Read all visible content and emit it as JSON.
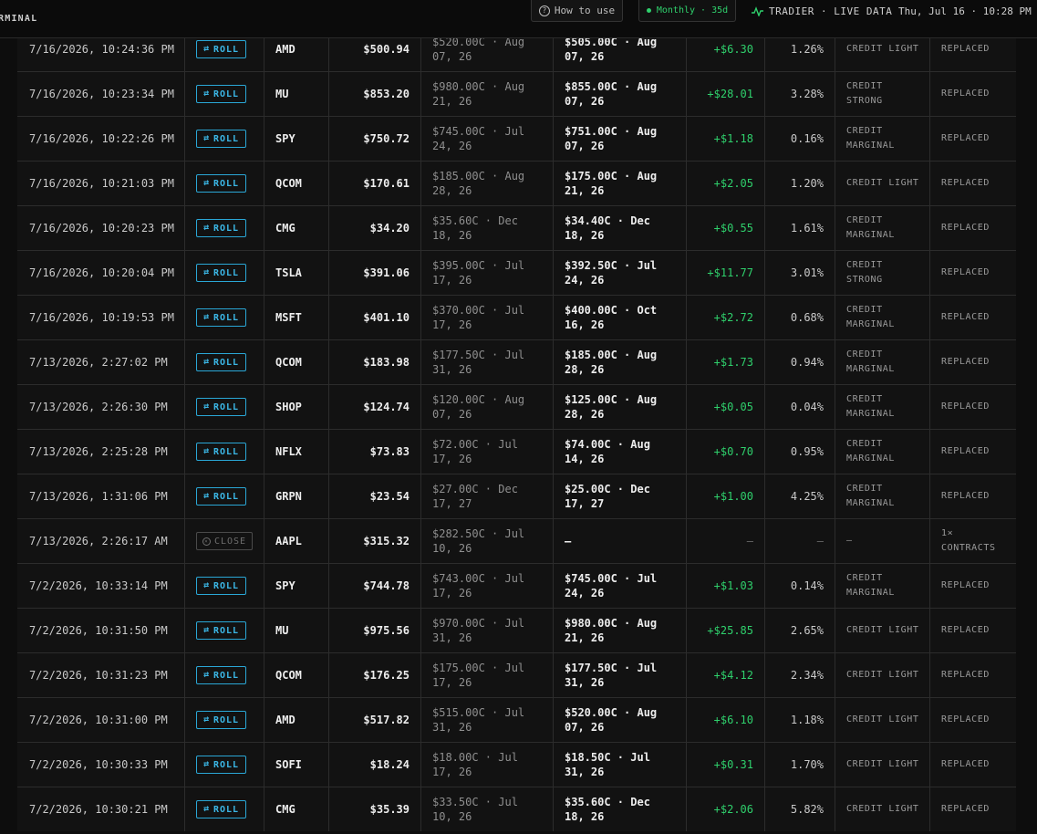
{
  "header": {
    "brand": "RMINAL",
    "how_to_use": "How to use",
    "cadence": "Monthly · 35d",
    "feed": "TRADIER · LIVE DATA",
    "clock": "Thu, Jul 16 · 10:28 PM"
  },
  "colors": {
    "accent_green": "#2fd06c",
    "roll_blue": "#3bb7e6",
    "background": "#0d0d0d"
  },
  "rows": [
    {
      "time": "7/16/2026, 10:24:36 PM",
      "action": "ROLL",
      "symbol": "AMD",
      "price": "$500.94",
      "old1": "$520.00C · Aug",
      "old2": "07, 26",
      "new1": "$505.00C · Aug",
      "new2": "07, 26",
      "delta": "+$6.30",
      "pct": "1.26%",
      "credit1": "CREDIT LIGHT",
      "credit2": "",
      "status1": "REPLACED",
      "status2": ""
    },
    {
      "time": "7/16/2026, 10:23:34 PM",
      "action": "ROLL",
      "symbol": "MU",
      "price": "$853.20",
      "old1": "$980.00C · Aug",
      "old2": "21, 26",
      "new1": "$855.00C · Aug",
      "new2": "07, 26",
      "delta": "+$28.01",
      "pct": "3.28%",
      "credit1": "CREDIT",
      "credit2": "STRONG",
      "status1": "REPLACED",
      "status2": ""
    },
    {
      "time": "7/16/2026, 10:22:26 PM",
      "action": "ROLL",
      "symbol": "SPY",
      "price": "$750.72",
      "old1": "$745.00C · Jul",
      "old2": "24, 26",
      "new1": "$751.00C · Aug",
      "new2": "07, 26",
      "delta": "+$1.18",
      "pct": "0.16%",
      "credit1": "CREDIT",
      "credit2": "MARGINAL",
      "status1": "REPLACED",
      "status2": ""
    },
    {
      "time": "7/16/2026, 10:21:03 PM",
      "action": "ROLL",
      "symbol": "QCOM",
      "price": "$170.61",
      "old1": "$185.00C · Aug",
      "old2": "28, 26",
      "new1": "$175.00C · Aug",
      "new2": "21, 26",
      "delta": "+$2.05",
      "pct": "1.20%",
      "credit1": "CREDIT LIGHT",
      "credit2": "",
      "status1": "REPLACED",
      "status2": ""
    },
    {
      "time": "7/16/2026, 10:20:23 PM",
      "action": "ROLL",
      "symbol": "CMG",
      "price": "$34.20",
      "old1": "$35.60C · Dec",
      "old2": "18, 26",
      "new1": "$34.40C · Dec",
      "new2": "18, 26",
      "delta": "+$0.55",
      "pct": "1.61%",
      "credit1": "CREDIT",
      "credit2": "MARGINAL",
      "status1": "REPLACED",
      "status2": ""
    },
    {
      "time": "7/16/2026, 10:20:04 PM",
      "action": "ROLL",
      "symbol": "TSLA",
      "price": "$391.06",
      "old1": "$395.00C · Jul",
      "old2": "17, 26",
      "new1": "$392.50C · Jul",
      "new2": "24, 26",
      "delta": "+$11.77",
      "pct": "3.01%",
      "credit1": "CREDIT",
      "credit2": "STRONG",
      "status1": "REPLACED",
      "status2": ""
    },
    {
      "time": "7/16/2026, 10:19:53 PM",
      "action": "ROLL",
      "symbol": "MSFT",
      "price": "$401.10",
      "old1": "$370.00C · Jul",
      "old2": "17, 26",
      "new1": "$400.00C · Oct",
      "new2": "16, 26",
      "delta": "+$2.72",
      "pct": "0.68%",
      "credit1": "CREDIT",
      "credit2": "MARGINAL",
      "status1": "REPLACED",
      "status2": ""
    },
    {
      "time": "7/13/2026, 2:27:02 PM",
      "action": "ROLL",
      "symbol": "QCOM",
      "price": "$183.98",
      "old1": "$177.50C · Jul",
      "old2": "31, 26",
      "new1": "$185.00C · Aug",
      "new2": "28, 26",
      "delta": "+$1.73",
      "pct": "0.94%",
      "credit1": "CREDIT",
      "credit2": "MARGINAL",
      "status1": "REPLACED",
      "status2": ""
    },
    {
      "time": "7/13/2026, 2:26:30 PM",
      "action": "ROLL",
      "symbol": "SHOP",
      "price": "$124.74",
      "old1": "$120.00C · Aug",
      "old2": "07, 26",
      "new1": "$125.00C · Aug",
      "new2": "28, 26",
      "delta": "+$0.05",
      "pct": "0.04%",
      "credit1": "CREDIT",
      "credit2": "MARGINAL",
      "status1": "REPLACED",
      "status2": ""
    },
    {
      "time": "7/13/2026, 2:25:28 PM",
      "action": "ROLL",
      "symbol": "NFLX",
      "price": "$73.83",
      "old1": "$72.00C · Jul",
      "old2": "17, 26",
      "new1": "$74.00C · Aug",
      "new2": "14, 26",
      "delta": "+$0.70",
      "pct": "0.95%",
      "credit1": "CREDIT",
      "credit2": "MARGINAL",
      "status1": "REPLACED",
      "status2": ""
    },
    {
      "time": "7/13/2026, 1:31:06 PM",
      "action": "ROLL",
      "symbol": "GRPN",
      "price": "$23.54",
      "old1": "$27.00C · Dec",
      "old2": "17, 27",
      "new1": "$25.00C · Dec",
      "new2": "17, 27",
      "delta": "+$1.00",
      "pct": "4.25%",
      "credit1": "CREDIT",
      "credit2": "MARGINAL",
      "status1": "REPLACED",
      "status2": ""
    },
    {
      "time": "7/13/2026, 2:26:17 AM",
      "action": "CLOSE",
      "symbol": "AAPL",
      "price": "$315.32",
      "old1": "$282.50C · Jul",
      "old2": "10, 26",
      "new1": "—",
      "new2": "",
      "delta": "—",
      "pct": "—",
      "credit1": "—",
      "credit2": "",
      "status1": "1×",
      "status2": "CONTRACTS"
    },
    {
      "time": "7/2/2026, 10:33:14 PM",
      "action": "ROLL",
      "symbol": "SPY",
      "price": "$744.78",
      "old1": "$743.00C · Jul",
      "old2": "17, 26",
      "new1": "$745.00C · Jul",
      "new2": "24, 26",
      "delta": "+$1.03",
      "pct": "0.14%",
      "credit1": "CREDIT",
      "credit2": "MARGINAL",
      "status1": "REPLACED",
      "status2": ""
    },
    {
      "time": "7/2/2026, 10:31:50 PM",
      "action": "ROLL",
      "symbol": "MU",
      "price": "$975.56",
      "old1": "$970.00C · Jul",
      "old2": "31, 26",
      "new1": "$980.00C · Aug",
      "new2": "21, 26",
      "delta": "+$25.85",
      "pct": "2.65%",
      "credit1": "CREDIT LIGHT",
      "credit2": "",
      "status1": "REPLACED",
      "status2": ""
    },
    {
      "time": "7/2/2026, 10:31:23 PM",
      "action": "ROLL",
      "symbol": "QCOM",
      "price": "$176.25",
      "old1": "$175.00C · Jul",
      "old2": "17, 26",
      "new1": "$177.50C · Jul",
      "new2": "31, 26",
      "delta": "+$4.12",
      "pct": "2.34%",
      "credit1": "CREDIT LIGHT",
      "credit2": "",
      "status1": "REPLACED",
      "status2": ""
    },
    {
      "time": "7/2/2026, 10:31:00 PM",
      "action": "ROLL",
      "symbol": "AMD",
      "price": "$517.82",
      "old1": "$515.00C · Jul",
      "old2": "31, 26",
      "new1": "$520.00C · Aug",
      "new2": "07, 26",
      "delta": "+$6.10",
      "pct": "1.18%",
      "credit1": "CREDIT LIGHT",
      "credit2": "",
      "status1": "REPLACED",
      "status2": ""
    },
    {
      "time": "7/2/2026, 10:30:33 PM",
      "action": "ROLL",
      "symbol": "SOFI",
      "price": "$18.24",
      "old1": "$18.00C · Jul",
      "old2": "17, 26",
      "new1": "$18.50C · Jul",
      "new2": "31, 26",
      "delta": "+$0.31",
      "pct": "1.70%",
      "credit1": "CREDIT LIGHT",
      "credit2": "",
      "status1": "REPLACED",
      "status2": ""
    },
    {
      "time": "7/2/2026, 10:30:21 PM",
      "action": "ROLL",
      "symbol": "CMG",
      "price": "$35.39",
      "old1": "$33.50C · Jul",
      "old2": "10, 26",
      "new1": "$35.60C · Dec",
      "new2": "18, 26",
      "delta": "+$2.06",
      "pct": "5.82%",
      "credit1": "CREDIT LIGHT",
      "credit2": "",
      "status1": "REPLACED",
      "status2": ""
    }
  ]
}
